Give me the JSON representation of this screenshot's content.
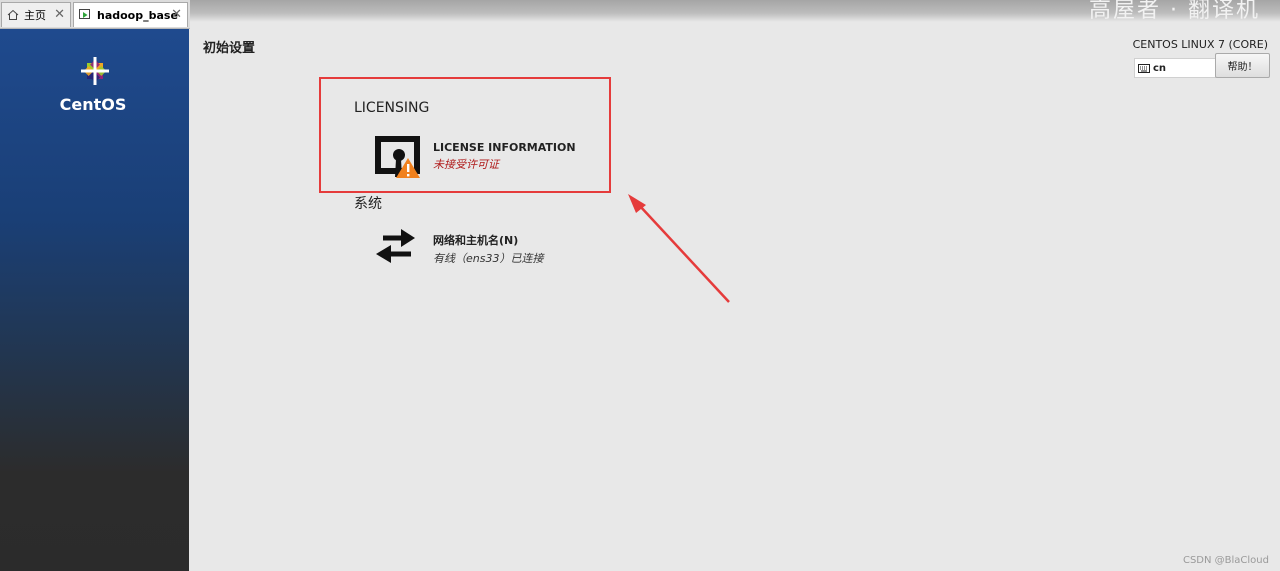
{
  "tabs": [
    {
      "label": "主页",
      "icon": "home-icon"
    },
    {
      "label": "hadoop_base",
      "icon": "vm-icon"
    }
  ],
  "topband": {
    "text": "高屋者 · 翻译机"
  },
  "logo": {
    "name": "CentOS"
  },
  "header": {
    "title": "初始设置",
    "product": "CENTOS LINUX 7 (CORE)",
    "keyboard": "cn",
    "help_label": "帮助！"
  },
  "sections": [
    {
      "title": "LICENSING",
      "spokes": [
        {
          "name": "LICENSE INFORMATION",
          "status": "未接受许可证",
          "icon": "license-warning-icon"
        }
      ]
    },
    {
      "title": "系统",
      "spokes": [
        {
          "name": "网络和主机名(N)",
          "status": "有线（ens33）已连接",
          "icon": "network-arrows-icon"
        }
      ]
    }
  ],
  "annotation": {
    "color": "#e53b3b"
  },
  "watermark": "CSDN @BlaCloud"
}
